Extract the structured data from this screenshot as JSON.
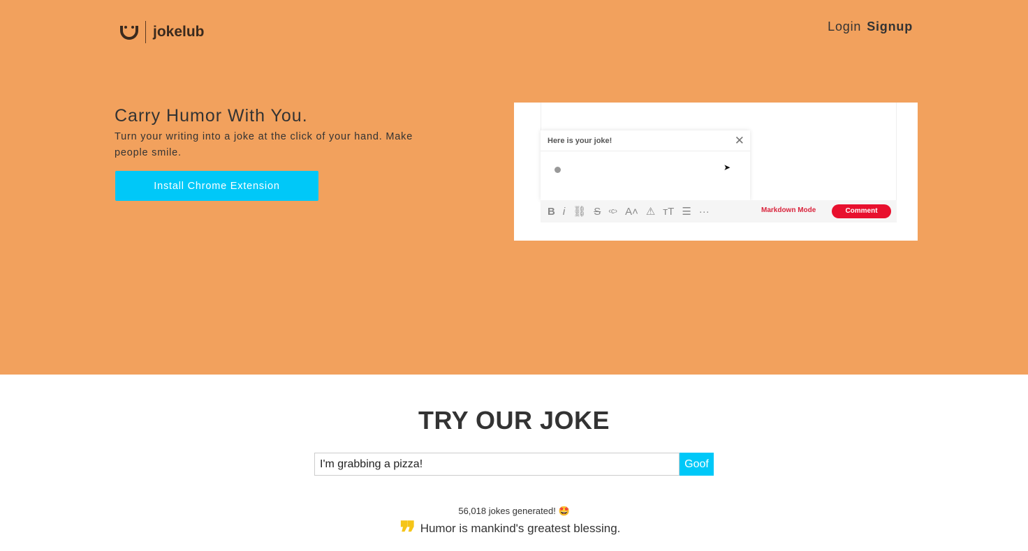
{
  "header": {
    "brand": "jokelub",
    "nav": {
      "login": "Login",
      "signup": "Signup"
    }
  },
  "hero": {
    "title": "Carry Humor With You.",
    "subtitle": "Turn your writing into a joke at the click of your hand. Make people smile.",
    "cta": "Install Chrome Extension",
    "demo": {
      "popup_title": "Here is your joke!",
      "markdown_mode": "Markdown Mode",
      "comment": "Comment"
    }
  },
  "try": {
    "title": "TRY OUR JOKE",
    "input_value": "I'm grabbing a pizza!",
    "button": "Goof",
    "count": "56,018 jokes generated! 🤩",
    "quote": "Humor is mankind's greatest blessing."
  },
  "colors": {
    "hero_bg": "#f2a15d",
    "accent": "#00c8f8"
  }
}
